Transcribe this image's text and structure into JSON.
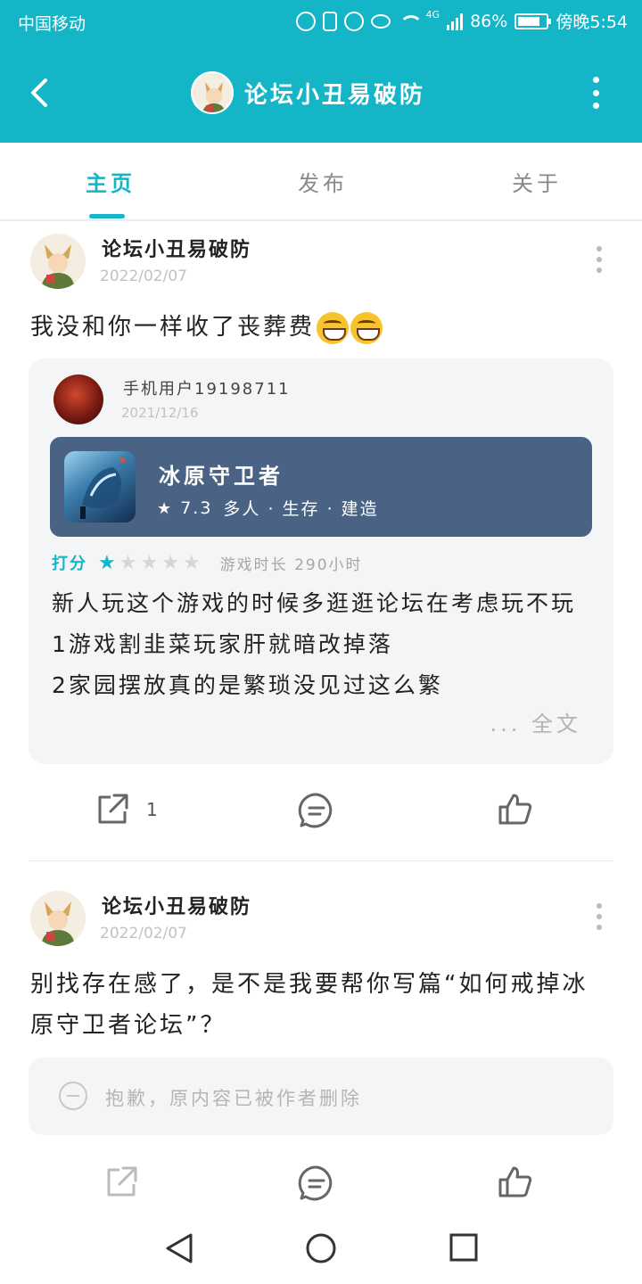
{
  "status_bar": {
    "carrier": "中国移动",
    "network": "4G",
    "battery": "86%",
    "time": "傍晚5:54"
  },
  "header": {
    "title": "论坛小丑易破防"
  },
  "tabs": [
    {
      "label": "主页",
      "active": true
    },
    {
      "label": "发布",
      "active": false
    },
    {
      "label": "关于",
      "active": false
    }
  ],
  "posts": [
    {
      "author": "论坛小丑易破防",
      "date": "2022/02/07",
      "text": "我没和你一样收了丧葬费",
      "emojis": [
        "grin-emoji",
        "grin-emoji"
      ],
      "quote": {
        "author": "手机用户19198711",
        "date": "2021/12/16",
        "game": {
          "title": "冰原守卫者",
          "score": "7.3",
          "tags": "多人 · 生存 · 建造"
        },
        "rating_label": "打分",
        "stars": 1,
        "stars_max": 5,
        "playtime": "游戏时长 290小时",
        "review_lines": [
          "新人玩这个游戏的时候多逛逛论坛在考虑玩不玩",
          "1游戏割韭菜玩家肝就暗改掉落",
          "2家园摆放真的是繁琐没见过这么繁"
        ],
        "more_label": "... 全文"
      },
      "share_count": "1"
    },
    {
      "author": "论坛小丑易破防",
      "date": "2022/02/07",
      "text": "别找存在感了，是不是我要帮你写篇“如何戒掉冰原守卫者论坛”？",
      "deleted_notice": "抱歉，原内容已被作者删除"
    }
  ],
  "colors": {
    "accent": "#14b5c6",
    "game_card": "#4a6283",
    "card_bg": "#f4f5f7"
  }
}
